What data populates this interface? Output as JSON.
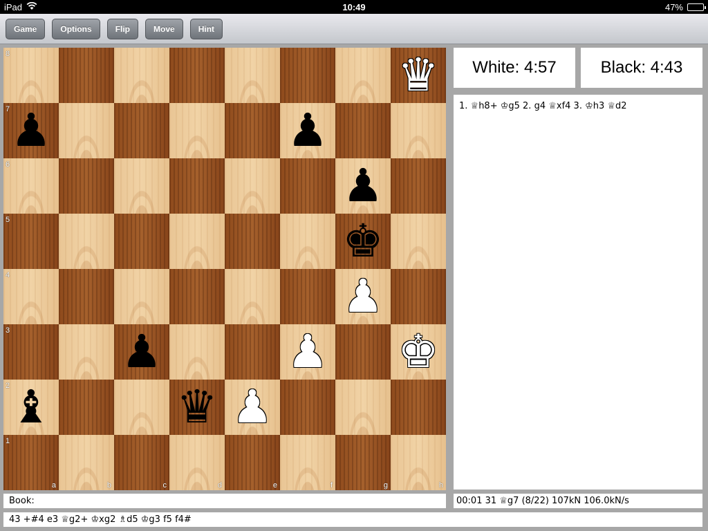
{
  "status_bar": {
    "device": "iPad",
    "time": "10:49",
    "battery": "47%",
    "battery_level": 0.47
  },
  "toolbar": {
    "buttons": [
      "Game",
      "Options",
      "Flip",
      "Move",
      "Hint"
    ]
  },
  "board": {
    "rank_labels": [
      "8",
      "7",
      "6",
      "5",
      "4",
      "3",
      "2",
      "1"
    ],
    "file_labels": [
      "a",
      "b",
      "c",
      "d",
      "e",
      "f",
      "g",
      "h"
    ],
    "pieces": [
      {
        "square": "h8",
        "type": "queen",
        "color": "white",
        "glyph": "♛"
      },
      {
        "square": "a7",
        "type": "pawn",
        "color": "black",
        "glyph": "♟"
      },
      {
        "square": "f7",
        "type": "pawn",
        "color": "black",
        "glyph": "♟"
      },
      {
        "square": "g6",
        "type": "pawn",
        "color": "black",
        "glyph": "♟"
      },
      {
        "square": "g5",
        "type": "king",
        "color": "black",
        "glyph": "♚"
      },
      {
        "square": "g4",
        "type": "pawn",
        "color": "white",
        "glyph": "♟"
      },
      {
        "square": "c3",
        "type": "pawn",
        "color": "black",
        "glyph": "♟"
      },
      {
        "square": "f3",
        "type": "pawn",
        "color": "white",
        "glyph": "♟"
      },
      {
        "square": "h3",
        "type": "king",
        "color": "white",
        "glyph": "♚"
      },
      {
        "square": "a2",
        "type": "bishop",
        "color": "black",
        "glyph": "♝"
      },
      {
        "square": "d2",
        "type": "queen",
        "color": "black",
        "glyph": "♛"
      },
      {
        "square": "e2",
        "type": "pawn",
        "color": "white",
        "glyph": "♟"
      }
    ]
  },
  "clocks": {
    "white": "White: 4:57",
    "black": "Black: 4:43"
  },
  "move_list": "1. ♕h8+ ♔g5 2. g4 ♕xf4 3. ♔h3 ♕d2",
  "book_line": "Book:",
  "engine_info": "00:01   31   ♕g7 (8/22)   107kN   106.0kN/s",
  "principal_variation": "43 +#4 e3 ♕g2+ ♔xg2 ♗d5 ♔g3 f5 f4#"
}
